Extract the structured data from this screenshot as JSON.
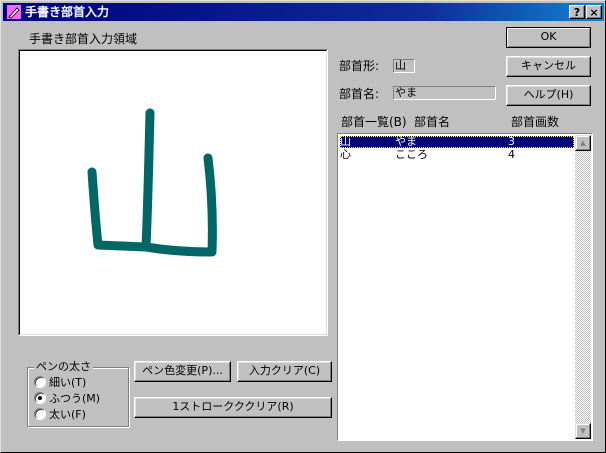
{
  "window": {
    "title": "手書き部首入力",
    "help_button": "?",
    "close_button": "×"
  },
  "canvas": {
    "label": "手書き部首入力領域",
    "stroke_color": "#006666"
  },
  "pen_width": {
    "title": "ペンの太さ",
    "options": [
      {
        "label": "細い(T)",
        "selected": false
      },
      {
        "label": "ふつう(M)",
        "selected": true
      },
      {
        "label": "太い(F)",
        "selected": false
      }
    ]
  },
  "buttons": {
    "pen_color": "ペン色変更(P)...",
    "clear_input": "入力クリア(C)",
    "clear_stroke": "1ストロークククリア(R)",
    "ok": "OK",
    "cancel": "キャンセル",
    "help": "ヘルプ(H)"
  },
  "radical": {
    "shape_label": "部首形:",
    "shape_value": "山",
    "name_label": "部首名:",
    "name_value": "やま"
  },
  "list": {
    "headers": [
      "部首一覧(B)",
      "部首名",
      "部首画数"
    ],
    "rows": [
      {
        "radical": "山",
        "name": "やま",
        "strokes": "3",
        "selected": true
      },
      {
        "radical": "心",
        "name": "こころ",
        "strokes": "4",
        "selected": false
      }
    ]
  },
  "icons": {
    "app": "pen-icon",
    "scroll_up": "arrow-up-icon",
    "scroll_down": "arrow-down-icon"
  }
}
